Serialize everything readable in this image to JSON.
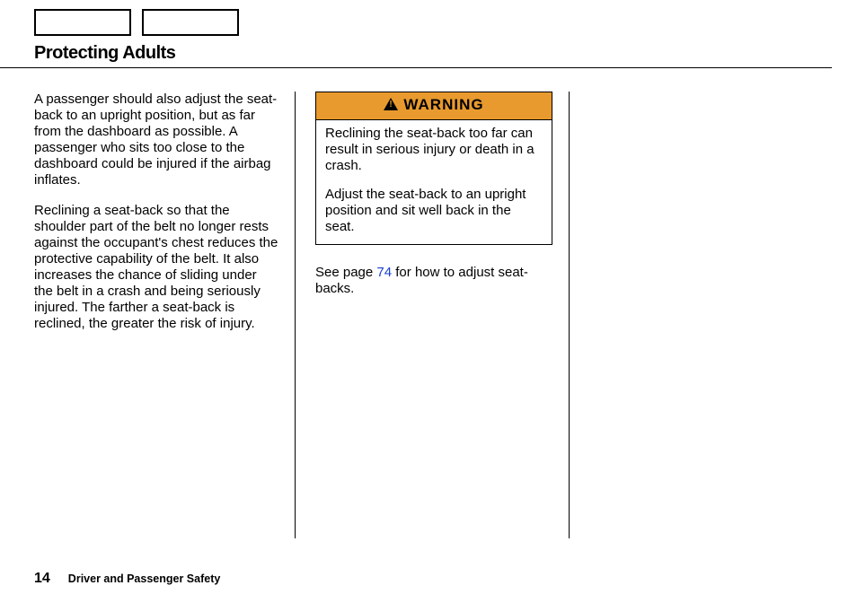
{
  "header": {
    "title": "Protecting Adults"
  },
  "column_left": {
    "para1": "A passenger should also adjust the seat-back to an upright position, but as far from the dashboard as possible. A passenger who sits too close to the dashboard could be injured if the airbag inflates.",
    "para2": "Reclining a seat-back so that the shoulder part of the belt no longer rests against the occupant's chest reduces the protective capability of the belt. It also increases the chance of sliding under the belt in a crash and being seriously injured. The farther a seat-back is reclined, the greater the risk of injury."
  },
  "column_right": {
    "warning": {
      "label": "WARNING",
      "para1": "Reclining the seat-back too far can result in serious injury or death in a crash.",
      "para2": "Adjust the seat-back to an upright position and sit well back in the seat."
    },
    "see_page_pre": "See page ",
    "see_page_link": "74",
    "see_page_post": " for how to adjust seat-backs."
  },
  "footer": {
    "page_number": "14",
    "section": "Driver and Passenger Safety"
  }
}
